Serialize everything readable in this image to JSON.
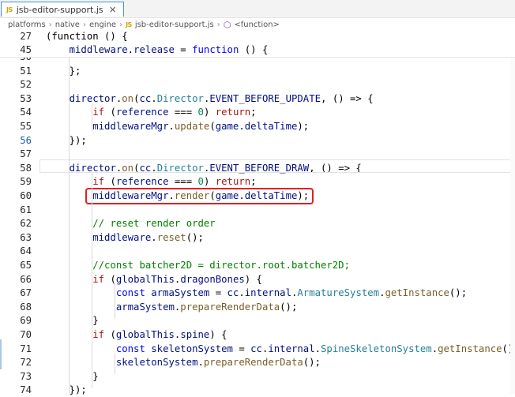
{
  "tab": {
    "badge": "JS",
    "filename": "jsb-editor-support.js",
    "close_glyph": "×"
  },
  "breadcrumb": {
    "parts": [
      "platforms",
      "native",
      "engine"
    ],
    "file": "jsb-editor-support.js",
    "symbol": "<function>",
    "sep": "›"
  },
  "sticky_lines": [
    {
      "num": "27",
      "tokens": [
        [
          "",
          "(function () {"
        ]
      ]
    },
    {
      "num": "45",
      "tokens": [
        [
          "",
          "    "
        ],
        [
          "id",
          "middleware"
        ],
        [
          "",
          "."
        ],
        [
          "id",
          "release"
        ],
        [
          "",
          " = "
        ],
        [
          "kw",
          "function"
        ],
        [
          "",
          " () {"
        ]
      ]
    }
  ],
  "lines": [
    {
      "num": "50",
      "tokens": [
        [
          "",
          ""
        ]
      ]
    },
    {
      "num": "51",
      "tokens": [
        [
          "",
          "    };"
        ]
      ]
    },
    {
      "num": "52",
      "tokens": [
        [
          "",
          ""
        ]
      ]
    },
    {
      "num": "53",
      "tokens": [
        [
          "",
          "    "
        ],
        [
          "id",
          "director"
        ],
        [
          "",
          "."
        ],
        [
          "fn",
          "on"
        ],
        [
          "",
          "("
        ],
        [
          "id",
          "cc"
        ],
        [
          "",
          "."
        ],
        [
          "ty",
          "Director"
        ],
        [
          "",
          "."
        ],
        [
          "id",
          "EVENT_BEFORE_UPDATE"
        ],
        [
          "",
          ", () => {"
        ]
      ]
    },
    {
      "num": "54",
      "tokens": [
        [
          "",
          "        "
        ],
        [
          "cf",
          "if"
        ],
        [
          "",
          " ("
        ],
        [
          "id",
          "reference"
        ],
        [
          "",
          " === "
        ],
        [
          "num",
          "0"
        ],
        [
          "",
          ") "
        ],
        [
          "cf",
          "return"
        ],
        [
          "",
          ";"
        ]
      ]
    },
    {
      "num": "55",
      "tokens": [
        [
          "",
          "        "
        ],
        [
          "id",
          "middlewareMgr"
        ],
        [
          "",
          "."
        ],
        [
          "fn",
          "update"
        ],
        [
          "",
          "("
        ],
        [
          "id",
          "game"
        ],
        [
          "",
          "."
        ],
        [
          "id",
          "deltaTime"
        ],
        [
          "",
          ");"
        ]
      ]
    },
    {
      "num": "56",
      "current": true,
      "tokens": [
        [
          "",
          "    });"
        ]
      ]
    },
    {
      "num": "57",
      "tokens": [
        [
          "",
          ""
        ]
      ]
    },
    {
      "num": "58",
      "tokens": [
        [
          "",
          "    "
        ],
        [
          "id",
          "director"
        ],
        [
          "",
          "."
        ],
        [
          "fn",
          "on"
        ],
        [
          "",
          "("
        ],
        [
          "id",
          "cc"
        ],
        [
          "",
          "."
        ],
        [
          "ty",
          "Director"
        ],
        [
          "",
          "."
        ],
        [
          "id",
          "EVENT_BEFORE_DRAW"
        ],
        [
          "",
          ", () => {"
        ]
      ]
    },
    {
      "num": "59",
      "tokens": [
        [
          "",
          "        "
        ],
        [
          "cf",
          "if"
        ],
        [
          "",
          " ("
        ],
        [
          "id",
          "reference"
        ],
        [
          "",
          " === "
        ],
        [
          "num",
          "0"
        ],
        [
          "",
          ") "
        ],
        [
          "cf",
          "return"
        ],
        [
          "",
          ";"
        ]
      ]
    },
    {
      "num": "60",
      "highlight": true,
      "tokens": [
        [
          "",
          "        "
        ],
        [
          "id",
          "middlewareMgr"
        ],
        [
          "",
          "."
        ],
        [
          "fn",
          "render"
        ],
        [
          "",
          "("
        ],
        [
          "id",
          "game"
        ],
        [
          "",
          "."
        ],
        [
          "id",
          "deltaTime"
        ],
        [
          "",
          ");"
        ]
      ]
    },
    {
      "num": "61",
      "tokens": [
        [
          "",
          ""
        ]
      ]
    },
    {
      "num": "62",
      "tokens": [
        [
          "",
          "        "
        ],
        [
          "cm",
          "// reset render order"
        ]
      ]
    },
    {
      "num": "63",
      "tokens": [
        [
          "",
          "        "
        ],
        [
          "id",
          "middleware"
        ],
        [
          "",
          "."
        ],
        [
          "fn",
          "reset"
        ],
        [
          "",
          "();"
        ]
      ]
    },
    {
      "num": "64",
      "tokens": [
        [
          "",
          ""
        ]
      ]
    },
    {
      "num": "65",
      "tokens": [
        [
          "",
          "        "
        ],
        [
          "cm",
          "//const batcher2D = director.root.batcher2D;"
        ]
      ]
    },
    {
      "num": "66",
      "tokens": [
        [
          "",
          "        "
        ],
        [
          "cf",
          "if"
        ],
        [
          "",
          " ("
        ],
        [
          "id",
          "globalThis"
        ],
        [
          "",
          "."
        ],
        [
          "id",
          "dragonBones"
        ],
        [
          "",
          ") {"
        ]
      ]
    },
    {
      "num": "67",
      "tokens": [
        [
          "",
          "            "
        ],
        [
          "kw",
          "const"
        ],
        [
          "",
          " "
        ],
        [
          "id",
          "armaSystem"
        ],
        [
          "",
          " = "
        ],
        [
          "id",
          "cc"
        ],
        [
          "",
          "."
        ],
        [
          "id",
          "internal"
        ],
        [
          "",
          "."
        ],
        [
          "ty",
          "ArmatureSystem"
        ],
        [
          "",
          "."
        ],
        [
          "fn",
          "getInstance"
        ],
        [
          "",
          "();"
        ]
      ]
    },
    {
      "num": "68",
      "tokens": [
        [
          "",
          "            "
        ],
        [
          "id",
          "armaSystem"
        ],
        [
          "",
          "."
        ],
        [
          "fn",
          "prepareRenderData"
        ],
        [
          "",
          "();"
        ]
      ]
    },
    {
      "num": "69",
      "tokens": [
        [
          "",
          "        }"
        ]
      ]
    },
    {
      "num": "70",
      "tokens": [
        [
          "",
          "        "
        ],
        [
          "cf",
          "if"
        ],
        [
          "",
          " ("
        ],
        [
          "id",
          "globalThis"
        ],
        [
          "",
          "."
        ],
        [
          "id",
          "spine"
        ],
        [
          "",
          ") {"
        ]
      ]
    },
    {
      "num": "71",
      "tokens": [
        [
          "",
          "            "
        ],
        [
          "kw",
          "const"
        ],
        [
          "",
          " "
        ],
        [
          "id",
          "skeletonSystem"
        ],
        [
          "",
          " = "
        ],
        [
          "id",
          "cc"
        ],
        [
          "",
          "."
        ],
        [
          "id",
          "internal"
        ],
        [
          "",
          "."
        ],
        [
          "ty",
          "SpineSkeletonSystem"
        ],
        [
          "",
          "."
        ],
        [
          "fn",
          "getInstance"
        ],
        [
          "",
          "();"
        ]
      ]
    },
    {
      "num": "72",
      "tokens": [
        [
          "",
          "            "
        ],
        [
          "id",
          "skeletonSystem"
        ],
        [
          "",
          "."
        ],
        [
          "fn",
          "prepareRenderData"
        ],
        [
          "",
          "();"
        ]
      ]
    },
    {
      "num": "73",
      "tokens": [
        [
          "",
          "        }"
        ]
      ]
    },
    {
      "num": "74",
      "tokens": [
        [
          "",
          "    });"
        ]
      ]
    }
  ]
}
